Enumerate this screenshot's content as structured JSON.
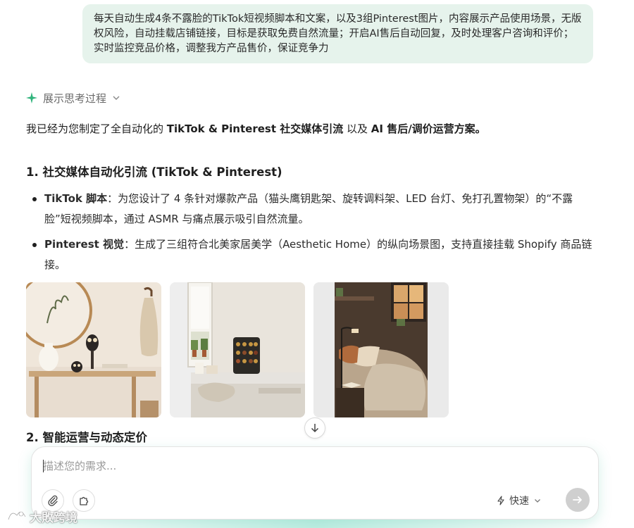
{
  "user_message": "每天自动生成4条不露脸的TikTok短视频脚本和文案，以及3组Pinterest图片，内容展示产品使用场景，无版权风险，自动挂载店铺链接，目标是获取免费自然流量；开启AI售后自动回复，及时处理客户咨询和评价；实时监控竞品价格，调整我方产品售价，保证竞争力",
  "thinking_toggle": {
    "label": "展示思考过程",
    "icon": "sparkle-icon",
    "accent": "#2fb37b"
  },
  "response": {
    "intro_prefix": "我已经为您制定了全自动化的 ",
    "intro_bold1": "TikTok & Pinterest 社交媒体引流",
    "intro_mid": " 以及 ",
    "intro_bold2": "AI 售后/调价运营方案。",
    "section1_title": "1. 社交媒体自动化引流 (TikTok & Pinterest)",
    "bullets": [
      {
        "label": "TikTok 脚本",
        "text": "：为您设计了 4 条针对爆款产品（猫头鹰钥匙架、旋转调料架、LED 台灯、免打孔置物架）的“不露脸”短视频脚本，通过 ASMR 与痛点展示吸引自然流量。"
      },
      {
        "label": "Pinterest 视觉",
        "text": "：生成了三组符合北美家居美学（Aesthetic Home）的纵向场景图，支持直接挂载 Shopify 商品链接。"
      }
    ],
    "section2_title": "2. 智能运营与动态定价"
  },
  "composer": {
    "placeholder": "描述您的需求...",
    "mode_label": "快速",
    "mode_icon": "lightning-icon",
    "send_color": "#cfcfcf"
  },
  "watermark": "大敗跨境"
}
